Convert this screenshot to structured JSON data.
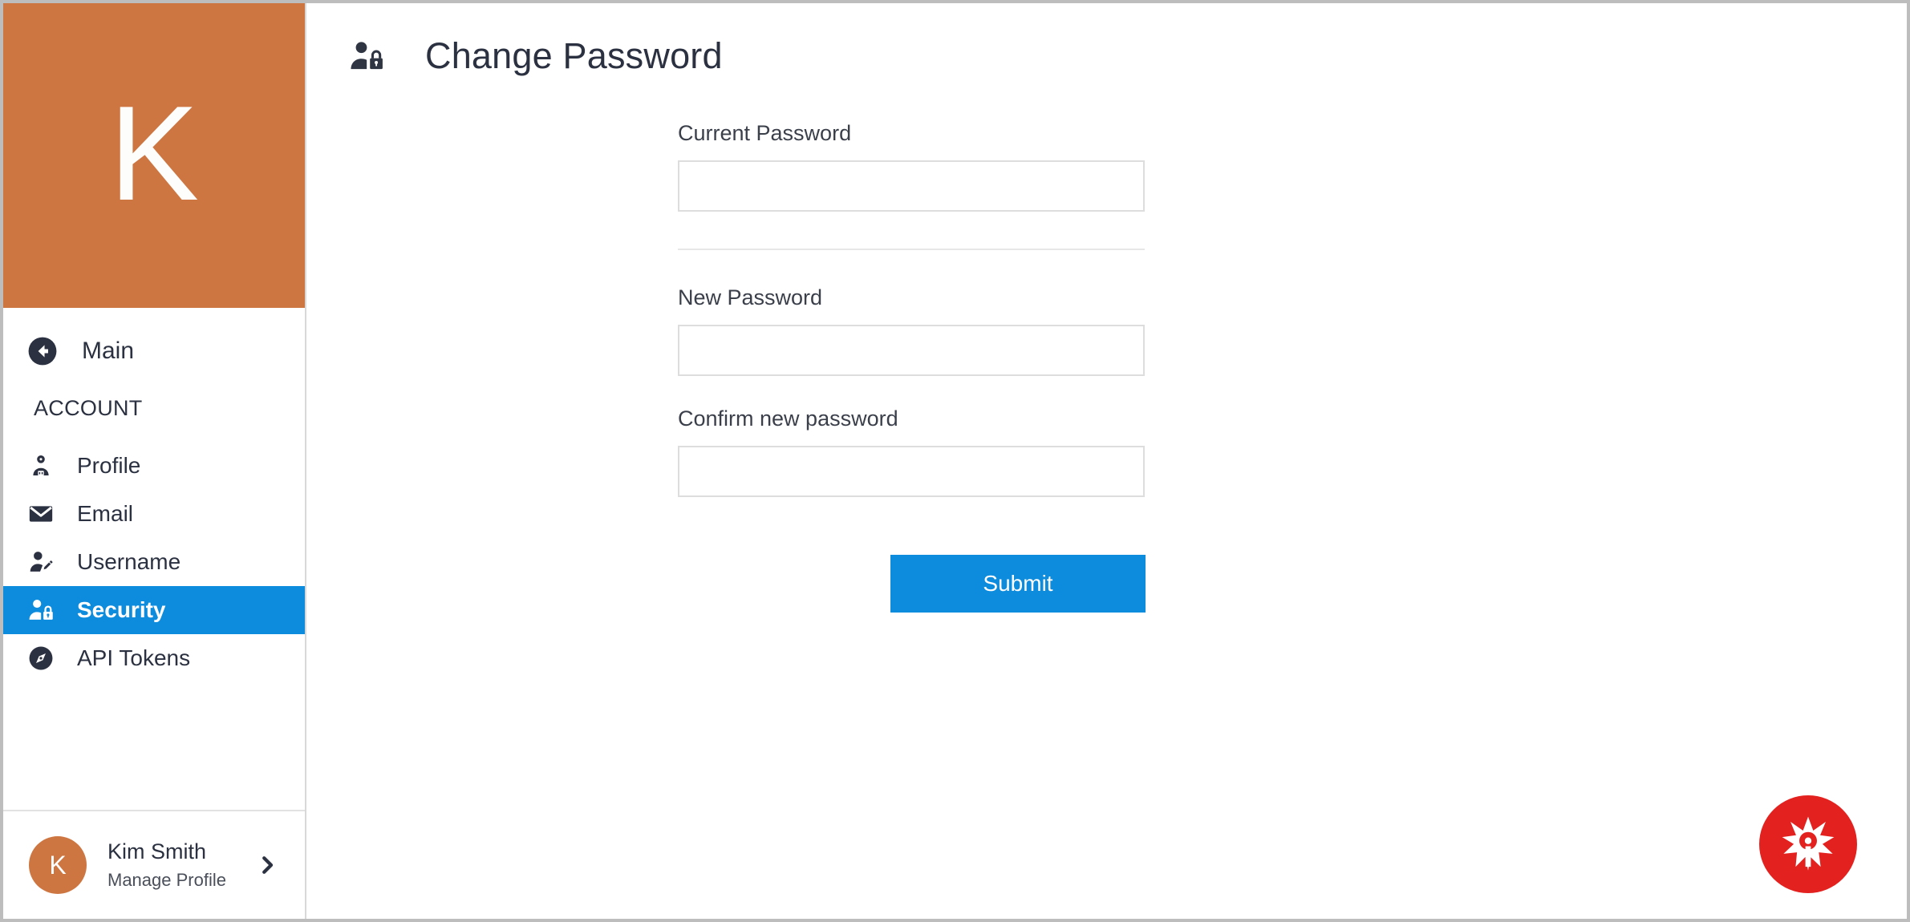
{
  "colors": {
    "brand_orange": "#ce7641",
    "accent_blue": "#0d8bdc",
    "fab_red": "#e3211f",
    "text_dark": "#2b3140",
    "border_gray": "#dddddd"
  },
  "sidebar": {
    "brand_letter": "K",
    "back": {
      "label": "Main",
      "icon": "arrow-left-circle-icon"
    },
    "section_title": "ACCOUNT",
    "items": [
      {
        "label": "Profile",
        "icon": "person-badge-icon",
        "active": false
      },
      {
        "label": "Email",
        "icon": "envelope-icon",
        "active": false
      },
      {
        "label": "Username",
        "icon": "person-pencil-icon",
        "active": false
      },
      {
        "label": "Security",
        "icon": "person-lock-icon",
        "active": true
      },
      {
        "label": "API Tokens",
        "icon": "compass-icon",
        "active": false
      }
    ],
    "footer": {
      "avatar_initial": "K",
      "name": "Kim Smith",
      "subtitle": "Manage Profile",
      "chevron_icon": "chevron-right-icon"
    }
  },
  "main": {
    "header": {
      "icon": "person-lock-icon",
      "title": "Change Password"
    },
    "form": {
      "fields": [
        {
          "label": "Current Password",
          "value": "",
          "placeholder": ""
        },
        {
          "label": "New Password",
          "value": "",
          "placeholder": ""
        },
        {
          "label": "Confirm new password",
          "value": "",
          "placeholder": ""
        }
      ],
      "submit_label": "Submit"
    },
    "fab": {
      "icon": "star-flower-icon",
      "label": ""
    }
  }
}
